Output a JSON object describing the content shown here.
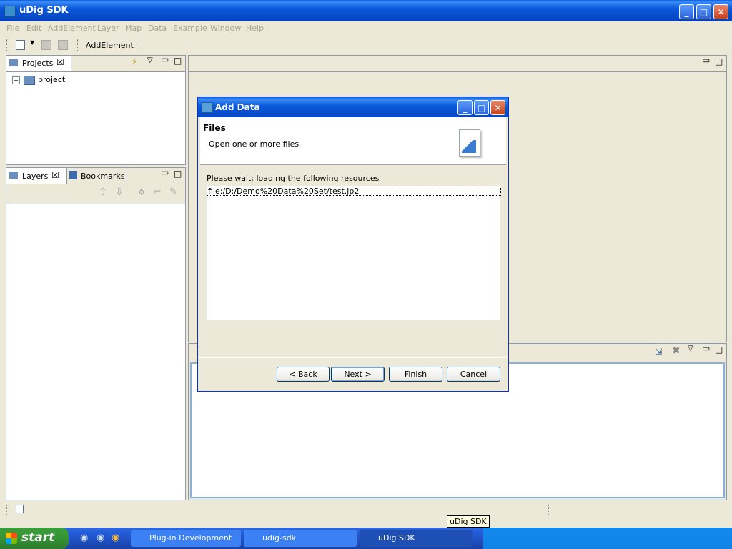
{
  "window": {
    "title": "uDig SDK"
  },
  "menu": [
    "File",
    "Edit",
    "AddElement",
    "Layer",
    "Map",
    "Data",
    "Example",
    "Window",
    "Help"
  ],
  "toolbar": {
    "add_element_label": "AddElement"
  },
  "projects_view": {
    "tab_label": "Projects",
    "items": [
      "project"
    ]
  },
  "layers_view": {
    "tab_label": "Layers",
    "bookmarks_label": "Bookmarks"
  },
  "dialog": {
    "title": "Add Data",
    "heading": "Files",
    "subheading": "Open one or more files",
    "message": "Please wait; loading the following resources",
    "resources": [
      "file:/D:/Demo%20Data%20Set/test.jp2"
    ],
    "buttons": {
      "back": "< Back",
      "next": "Next >",
      "finish": "Finish",
      "cancel": "Cancel"
    }
  },
  "tooltip": "uDig SDK",
  "taskbar": {
    "start_label": "start",
    "items": [
      "Plug-in Development",
      "udig-sdk",
      "uDig SDK"
    ]
  },
  "colors": {
    "titlebar": "#0a58d8",
    "dialog_border": "#0831d9",
    "start_button": "#379a37"
  }
}
